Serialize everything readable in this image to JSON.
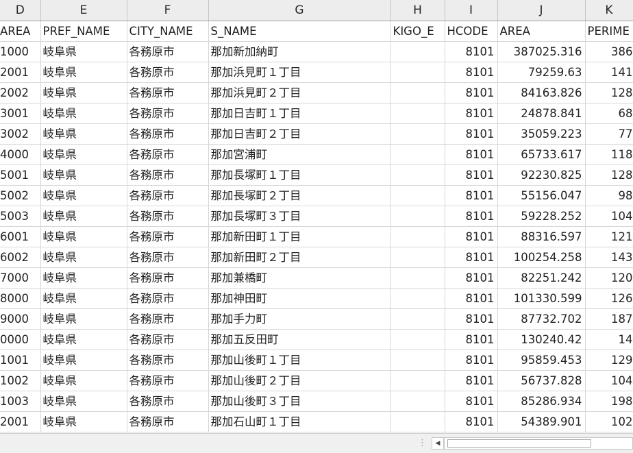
{
  "columns": [
    "D",
    "E",
    "F",
    "G",
    "H",
    "I",
    "J",
    "K"
  ],
  "field_headers": [
    "AREA",
    "PREF_NAME",
    "CITY_NAME",
    "S_NAME",
    "KIGO_E",
    "HCODE",
    "AREA",
    "PERIME"
  ],
  "rows": [
    [
      "1000",
      "岐阜県",
      "各務原市",
      "那加新加納町",
      "",
      "8101",
      "387025.316",
      "386"
    ],
    [
      "2001",
      "岐阜県",
      "各務原市",
      "那加浜見町１丁目",
      "",
      "8101",
      "79259.63",
      "141"
    ],
    [
      "2002",
      "岐阜県",
      "各務原市",
      "那加浜見町２丁目",
      "",
      "8101",
      "84163.826",
      "128"
    ],
    [
      "3001",
      "岐阜県",
      "各務原市",
      "那加日吉町１丁目",
      "",
      "8101",
      "24878.841",
      "68"
    ],
    [
      "3002",
      "岐阜県",
      "各務原市",
      "那加日吉町２丁目",
      "",
      "8101",
      "35059.223",
      "77"
    ],
    [
      "4000",
      "岐阜県",
      "各務原市",
      "那加宮浦町",
      "",
      "8101",
      "65733.617",
      "118"
    ],
    [
      "5001",
      "岐阜県",
      "各務原市",
      "那加長塚町１丁目",
      "",
      "8101",
      "92230.825",
      "128"
    ],
    [
      "5002",
      "岐阜県",
      "各務原市",
      "那加長塚町２丁目",
      "",
      "8101",
      "55156.047",
      "98"
    ],
    [
      "5003",
      "岐阜県",
      "各務原市",
      "那加長塚町３丁目",
      "",
      "8101",
      "59228.252",
      "104"
    ],
    [
      "6001",
      "岐阜県",
      "各務原市",
      "那加新田町１丁目",
      "",
      "8101",
      "88316.597",
      "121"
    ],
    [
      "6002",
      "岐阜県",
      "各務原市",
      "那加新田町２丁目",
      "",
      "8101",
      "100254.258",
      "143"
    ],
    [
      "7000",
      "岐阜県",
      "各務原市",
      "那加兼橋町",
      "",
      "8101",
      "82251.242",
      "120"
    ],
    [
      "8000",
      "岐阜県",
      "各務原市",
      "那加神田町",
      "",
      "8101",
      "101330.599",
      "126"
    ],
    [
      "9000",
      "岐阜県",
      "各務原市",
      "那加手力町",
      "",
      "8101",
      "87732.702",
      "187"
    ],
    [
      "0000",
      "岐阜県",
      "各務原市",
      "那加五反田町",
      "",
      "8101",
      "130240.42",
      "14"
    ],
    [
      "1001",
      "岐阜県",
      "各務原市",
      "那加山後町１丁目",
      "",
      "8101",
      "95859.453",
      "129"
    ],
    [
      "1002",
      "岐阜県",
      "各務原市",
      "那加山後町２丁目",
      "",
      "8101",
      "56737.828",
      "104"
    ],
    [
      "1003",
      "岐阜県",
      "各務原市",
      "那加山後町３丁目",
      "",
      "8101",
      "85286.934",
      "198"
    ],
    [
      "2001",
      "岐阜県",
      "各務原市",
      "那加石山町１丁目",
      "",
      "8101",
      "54389.901",
      "102"
    ]
  ],
  "icons": {
    "scroll_left": "triangle-left-icon",
    "splitter": "vertical-dots-icon"
  },
  "colors": {
    "header_bg": "#ededed",
    "gridline": "#d7d7d7",
    "statusbar_bg": "#f0f0f0"
  }
}
